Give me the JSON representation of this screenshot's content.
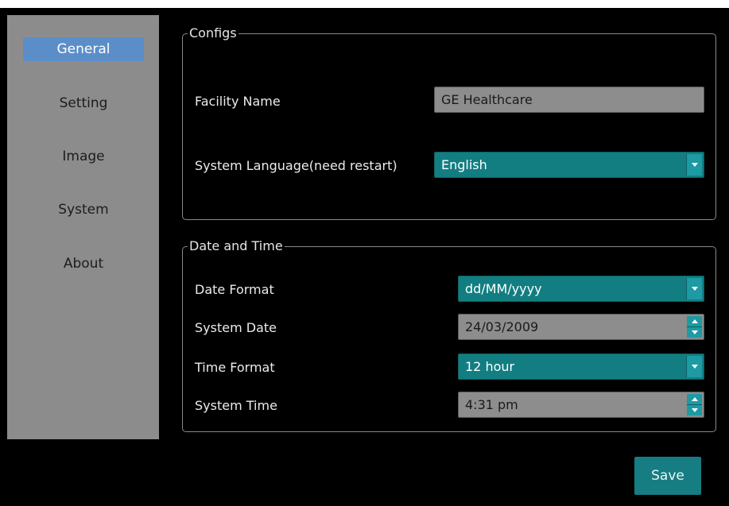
{
  "nav": {
    "items": [
      {
        "label": "General"
      },
      {
        "label": "Setting"
      },
      {
        "label": "Image"
      },
      {
        "label": "System"
      },
      {
        "label": "About"
      }
    ],
    "selected": "General"
  },
  "configs": {
    "title": "Configs",
    "facility_name_label": "Facility Name",
    "facility_name_value": "GE Healthcare",
    "language_label": "System Language(need restart)",
    "language_value": "English"
  },
  "datetime": {
    "title": "Date and Time",
    "date_format_label": "Date Format",
    "date_format_value": "dd/MM/yyyy",
    "system_date_label": "System Date",
    "system_date_value": "24/03/2009",
    "time_format_label": "Time Format",
    "time_format_value": "12 hour",
    "system_time_label": "System Time",
    "system_time_value": "4:31 pm"
  },
  "actions": {
    "save_label": "Save"
  },
  "icons": {
    "dropdown": "chevron-down-icon",
    "spinner": "up-down-spinner-icon"
  },
  "colors": {
    "select_bg": "#127e82",
    "accent": "#1d9aa3",
    "nav_active": "#5b8ec9",
    "panel": "#8c8c8c"
  }
}
